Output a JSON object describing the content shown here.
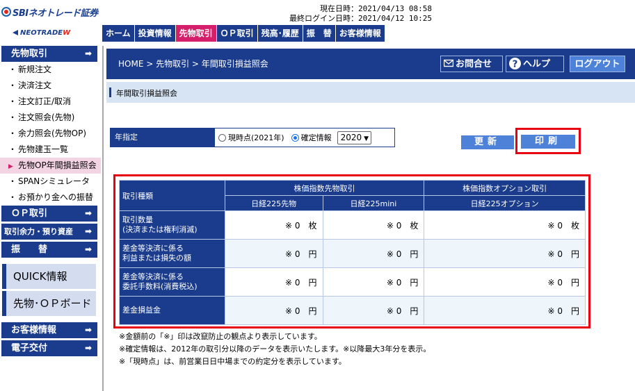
{
  "logo": {
    "sbi": "SBIネオトレード証券",
    "neo_main": "NEOTRADE",
    "neo_w": "W"
  },
  "header": {
    "current_time": "現在日時：2021/04/13 08:58",
    "last_login": "最終ログイン日時：2021/04/12 10:25"
  },
  "nav": [
    "ホーム",
    "投資情報",
    "先物取引",
    "ＯＰ取引",
    "残高･履歴",
    "振　替",
    "お客様情報"
  ],
  "sidebar": {
    "head_futures": "先物取引",
    "items": [
      "新規注文",
      "決済注文",
      "注文訂正/取消",
      "注文照会(先物)",
      "余力照会(先物OP)",
      "先物建玉一覧",
      "先物OP年間損益照会",
      "SPANシミュレータ",
      "お預かり金への振替"
    ],
    "head_op": "ＯＰ取引",
    "head_margin": "取引余力・預り資産",
    "head_transfer": "振　　替",
    "quick": "QUICK情報",
    "board": "先物･ＯＰボード",
    "head_customer": "お客様情報",
    "head_edelivery": "電子交付",
    "arrow": "➡"
  },
  "breadcrumb": "HOME > 先物取引 > 年間取引損益照会",
  "buttons": {
    "contact": "お問合せ",
    "help": "ヘルプ",
    "logout": "ログアウト",
    "update": "更新",
    "print": "印刷"
  },
  "page_title": "年間取引損益照会",
  "year": {
    "label": "年指定",
    "option_now": "現時点(2021年)",
    "option_fixed": "確定情報",
    "selected": "2020"
  },
  "table": {
    "col_type": "取引種類",
    "group_futures": "株価指数先物取引",
    "group_options": "株価指数オプション取引",
    "sub": [
      "日経225先物",
      "日経225mini",
      "日経225オプション"
    ],
    "rows": [
      {
        "label1": "取引数量",
        "label2": "(決済または権利消滅)",
        "vals": [
          "※ 0　枚",
          "※ 0　枚",
          "※ 0　枚"
        ]
      },
      {
        "label1": "差金等決済に係る",
        "label2": "利益または損失の額",
        "vals": [
          "※ 0　円",
          "※ 0　円",
          "※ 0　円"
        ]
      },
      {
        "label1": "差金等決済に係る",
        "label2": "委託手数料(消費税込)",
        "vals": [
          "※ 0　円",
          "※ 0　円",
          "※ 0　円"
        ]
      },
      {
        "label1": "差金損益金",
        "label2": "",
        "vals": [
          "※ 0　円",
          "※ 0　円",
          "※ 0　円"
        ]
      }
    ]
  },
  "notes": [
    "※金額前の「※」印は改竄防止の観点より表示しています。",
    "※確定情報は、2012年の取引分以降のデータを表示いたします。※以降最大3年分を表示。",
    "※「現時点」は、前営業日日中場までの約定分を表示しています。"
  ]
}
